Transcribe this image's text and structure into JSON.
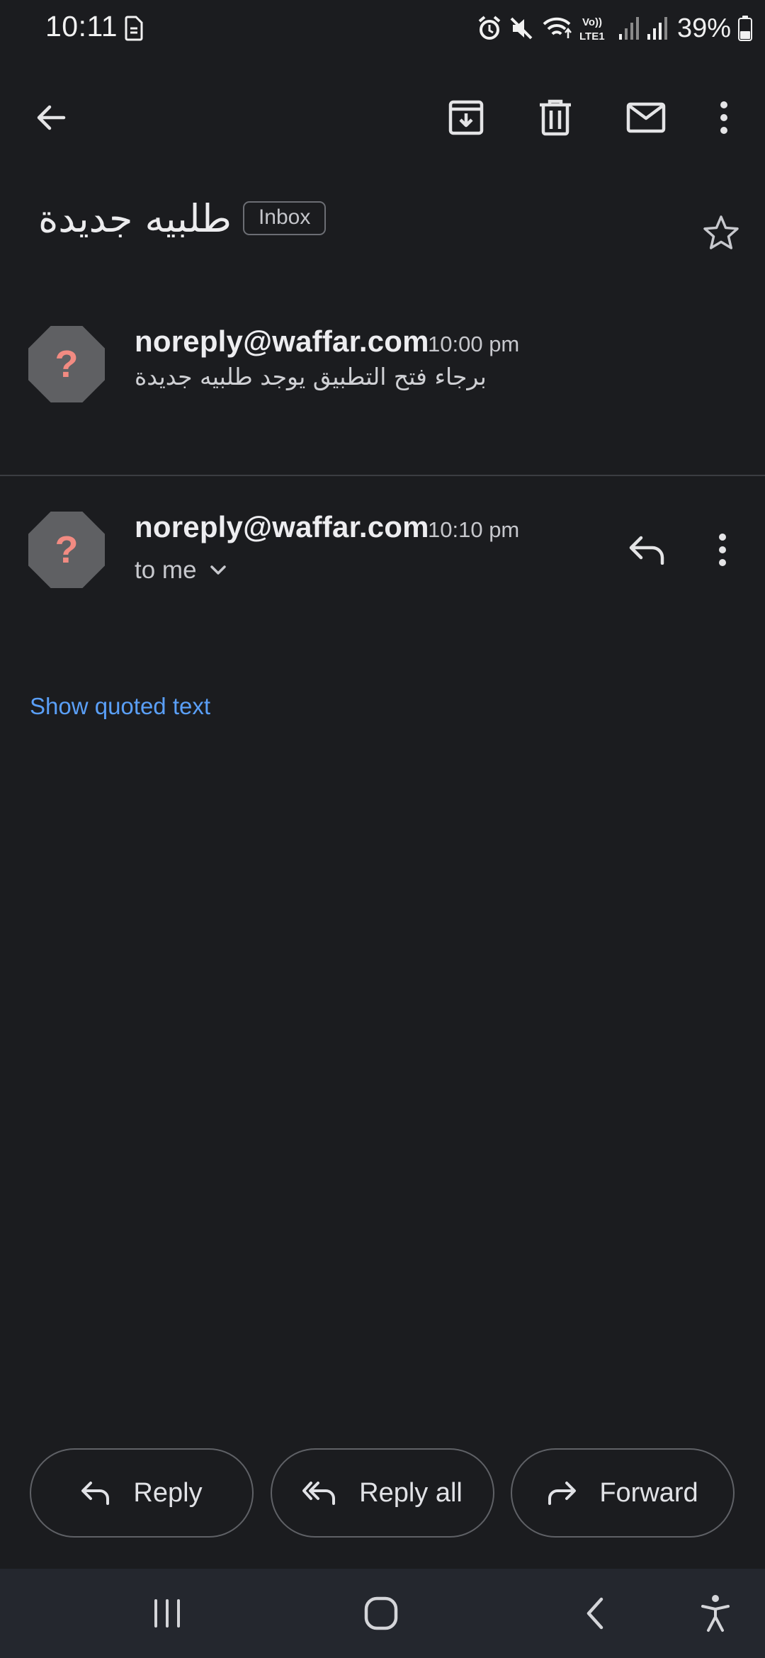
{
  "status_bar": {
    "time": "10:11",
    "battery_percent": "39%",
    "lte_label_top": "Vo))",
    "lte_label_bottom": "LTE1"
  },
  "toolbar": {
    "icons": [
      "back-arrow-icon",
      "archive-icon",
      "delete-icon",
      "mark-unread-icon",
      "more-vert-icon"
    ]
  },
  "email": {
    "subject": "طلبيه جديدة",
    "label_chip": "Inbox",
    "starred": false
  },
  "messages": [
    {
      "sender": "noreply@waffar.com",
      "time": "10:00 pm",
      "snippet": "برجاء فتح التطبيق يوجد طلبيه جديدة",
      "avatar_symbol": "?"
    },
    {
      "sender": "noreply@waffar.com",
      "time": "10:10 pm",
      "recipient_line": "to me",
      "avatar_symbol": "?"
    }
  ],
  "quoted_text_link": "Show quoted text",
  "actions": {
    "reply": "Reply",
    "reply_all": "Reply all",
    "forward": "Forward"
  },
  "colors": {
    "background": "#1b1c1f",
    "accent_link": "#5a9ff7",
    "avatar_bg": "#5f6063",
    "avatar_symbol": "#f28b82",
    "nav_bar": "#24272e"
  }
}
